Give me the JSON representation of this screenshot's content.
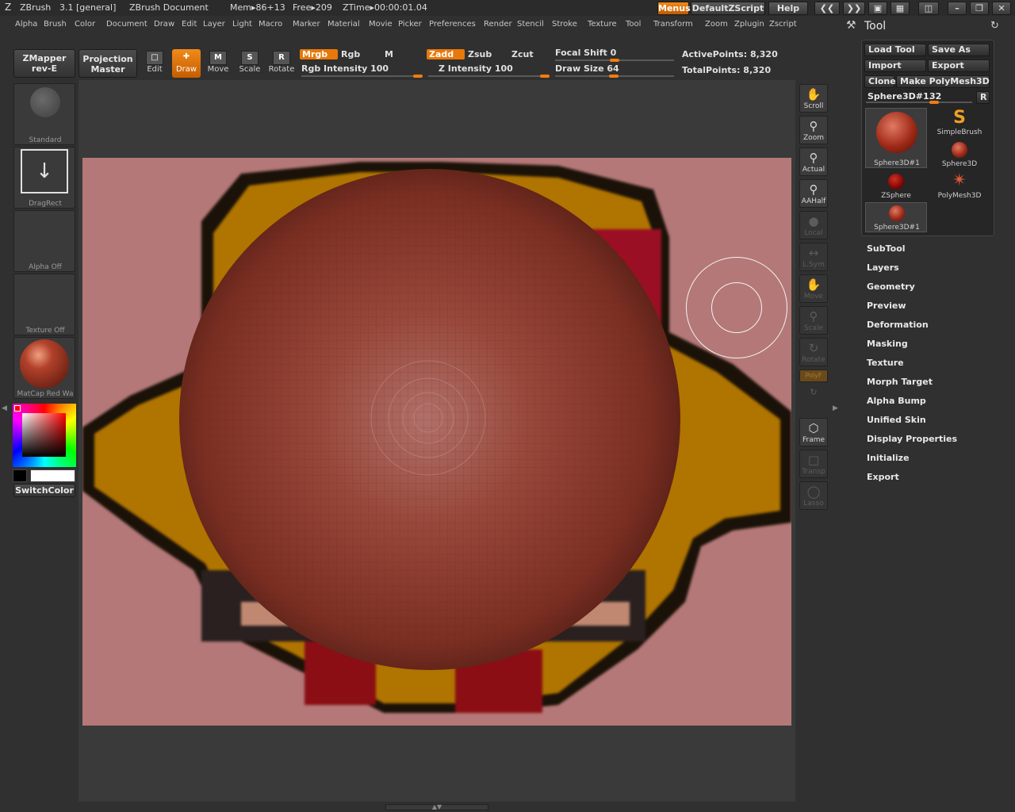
{
  "titlebar": {
    "app": "ZBrush",
    "version": "3.1 [general]",
    "document": "ZBrush Document",
    "mem": "Mem▸86+13",
    "free": "Free▸209",
    "ztime": "ZTime▸00:00:01.04",
    "menus_btn": "Menus",
    "script_btn": "DefaultZScript",
    "help_btn": "Help"
  },
  "menubar": [
    "Alpha",
    "Brush",
    "Color",
    "Document",
    "Draw",
    "Edit",
    "Layer",
    "Light",
    "Macro",
    "Marker",
    "Material",
    "Movie",
    "Picker",
    "Preferences",
    "Render",
    "Stencil",
    "Stroke",
    "Texture",
    "Tool",
    "Transform",
    "Zoom",
    "Zplugin",
    "Zscript"
  ],
  "shelf": {
    "zmapper_line1": "ZMapper",
    "zmapper_line2": "rev-E",
    "projection_line1": "Projection",
    "projection_line2": "Master",
    "edit": "Edit",
    "draw": "Draw",
    "move": "Move",
    "scale": "Scale",
    "rotate": "Rotate",
    "mrgb": "Mrgb",
    "rgb": "Rgb",
    "m": "M",
    "rgb_intensity": "Rgb Intensity 100",
    "zadd": "Zadd",
    "zsub": "Zsub",
    "zcut": "Zcut",
    "z_intensity": "Z Intensity 100",
    "focal_shift": "Focal Shift 0",
    "draw_size": "Draw Size 64",
    "active_points": "ActivePoints: 8,320",
    "total_points": "TotalPoints: 8,320"
  },
  "leftshelf": {
    "brush": "Standard",
    "stroke": "DragRect",
    "alpha": "Alpha  Off",
    "texture": "Texture  Off",
    "material": "MatCap  Red  Wa",
    "switch_color": "SwitchColor"
  },
  "rightshelf": [
    "Scroll",
    "Zoom",
    "Actual",
    "AAHalf",
    "Local",
    "L.Sym",
    "Move",
    "Scale",
    "Rotate",
    "PolyF",
    "",
    "Frame",
    "Transp",
    "Lasso"
  ],
  "toolpanel": {
    "title": "Tool",
    "load_tool": "Load Tool",
    "save_as": "Save As",
    "import": "Import",
    "export": "Export",
    "clone": "Clone",
    "make_polymesh": "Make PolyMesh3D",
    "current_tool": "Sphere3D#1.",
    "current_tool_value": "32",
    "r_btn": "R",
    "thumbs": [
      "Sphere3D#1",
      "SimpleBrush",
      "Sphere3D",
      "ZSphere",
      "PolyMesh3D",
      "Sphere3D#1"
    ],
    "sections": [
      "SubTool",
      "Layers",
      "Geometry",
      "Preview",
      "Deformation",
      "Masking",
      "Texture",
      "Morph Target",
      "Alpha Bump",
      "Unified Skin",
      "Display Properties",
      "Initialize",
      "Export"
    ]
  },
  "colors": {
    "accent": "#e8780a",
    "canvas_bg": "#b47878",
    "sphere": "#8c3a2c",
    "ui_bg": "#303030"
  }
}
